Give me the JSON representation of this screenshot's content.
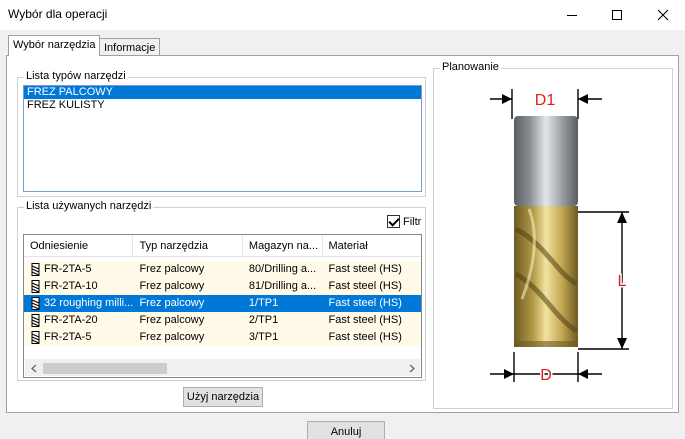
{
  "window": {
    "title": "Wybór dla operacji"
  },
  "tabs": [
    {
      "label": "Wybór narzędzia",
      "active": true
    },
    {
      "label": "Informacje",
      "active": false
    }
  ],
  "tool_types": {
    "legend": "Lista typów narzędzi",
    "items": [
      {
        "label": "FREZ PALCOWY",
        "selected": true
      },
      {
        "label": "FREZ KULISTY",
        "selected": false
      }
    ]
  },
  "used_tools": {
    "legend": "Lista używanych narzędzi",
    "filter_label": "Filtr",
    "filter_checked": true,
    "columns": [
      "Odniesienie",
      "Typ narzędzia",
      "Magazyn na...",
      "Materiał"
    ],
    "rows": [
      {
        "ref": "FR-2TA-5",
        "type": "Frez palcowy",
        "magazine": "80/Drilling a...",
        "material": "Fast steel (HS)",
        "selected": false
      },
      {
        "ref": "FR-2TA-10",
        "type": "Frez palcowy",
        "magazine": "81/Drilling a...",
        "material": "Fast steel (HS)",
        "selected": false
      },
      {
        "ref": "32 roughing milli...",
        "type": "Frez palcowy",
        "magazine": "1/TP1",
        "material": "Fast steel (HS)",
        "selected": true
      },
      {
        "ref": "FR-2TA-20",
        "type": "Frez palcowy",
        "magazine": "2/TP1",
        "material": "Fast steel (HS)",
        "selected": false
      },
      {
        "ref": "FR-2TA-5",
        "type": "Frez palcowy",
        "magazine": "3/TP1",
        "material": "Fast steel (HS)",
        "selected": false
      }
    ]
  },
  "buttons": {
    "use_tool": "Użyj narzędzia",
    "cancel": "Anuluj"
  },
  "planning": {
    "legend": "Planowanie",
    "dim_d1": "D1",
    "dim_l": "L",
    "dim_d": "D",
    "dim_color": "#e0201a"
  }
}
